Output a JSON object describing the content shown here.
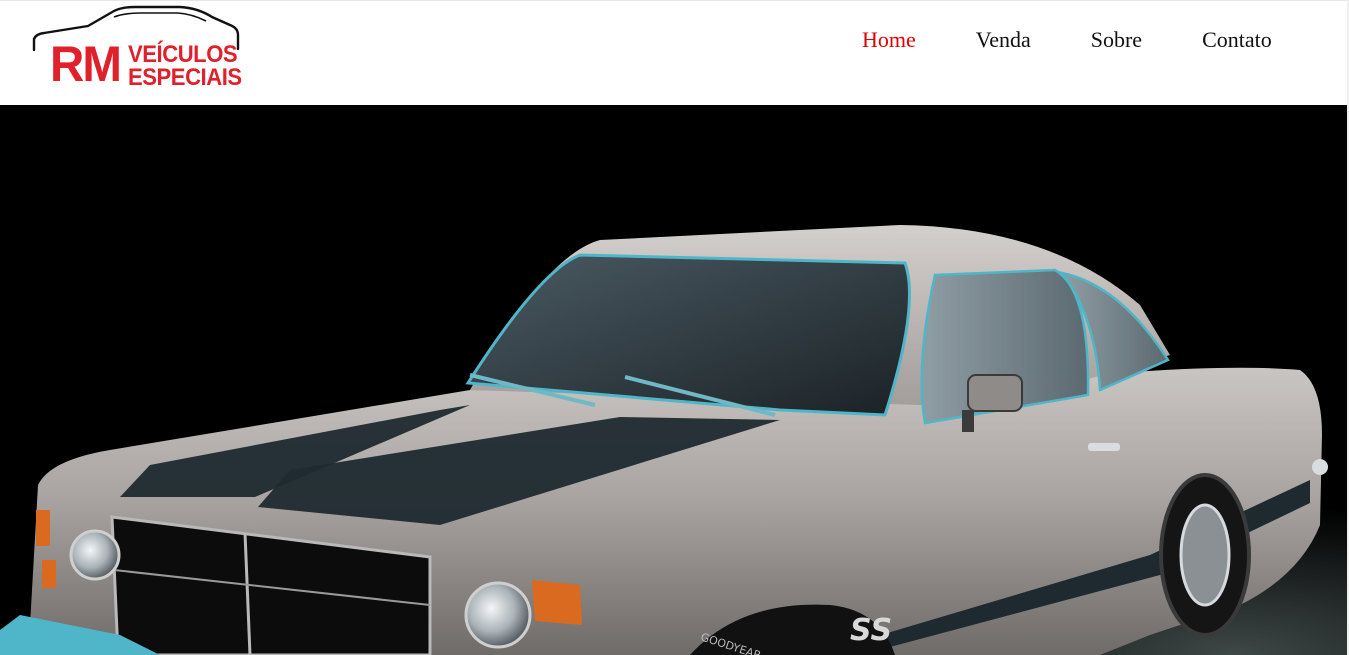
{
  "brand": {
    "logo_rm": "RM",
    "logo_line1": "VEÍCULOS",
    "logo_line2": "ESPECIAIS"
  },
  "nav": {
    "items": [
      {
        "label": "Home",
        "active": true
      },
      {
        "label": "Venda",
        "active": false
      },
      {
        "label": "Sobre",
        "active": false
      },
      {
        "label": "Contato",
        "active": false
      }
    ]
  },
  "hero": {
    "image": "car-photo",
    "badge": "SS",
    "tire_text": "GOODYEAR"
  },
  "colors": {
    "brand_red": "#e0202a",
    "nav_active": "#e00000",
    "nav_text": "#111111",
    "hero_bg": "#000000",
    "car_body": "#a8a3a0",
    "stripe": "#1f2a30",
    "trim": "#4fb6c9"
  }
}
